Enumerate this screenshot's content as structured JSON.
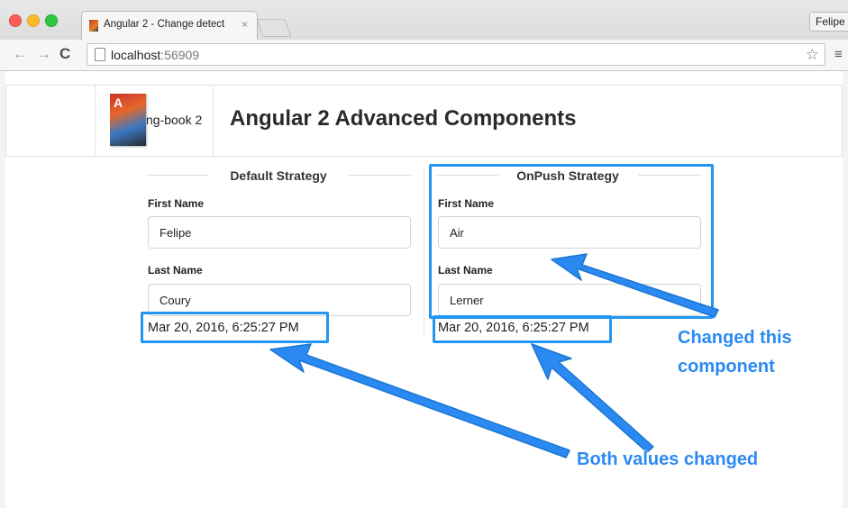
{
  "browser": {
    "tab_title": "Angular 2 - Change detect",
    "tab_close": "×",
    "user_button": "Felipe",
    "url_host": "localhost",
    "url_port": ":56909"
  },
  "header": {
    "brand_letter": "A",
    "brand_text": "ng-book 2",
    "title": "Angular 2 Advanced Components"
  },
  "default_strategy": {
    "legend": "Default Strategy",
    "first_name_label": "First Name",
    "first_name_value": "Felipe",
    "last_name_label": "Last Name",
    "last_name_value": "Coury",
    "timestamp": "Mar 20, 2016, 6:25:27 PM"
  },
  "onpush_strategy": {
    "legend": "OnPush Strategy",
    "first_name_label": "First Name",
    "first_name_value": "Air",
    "last_name_label": "Last Name",
    "last_name_value": "Lerner",
    "timestamp": "Mar 20, 2016, 6:25:27 PM"
  },
  "annotations": {
    "changed_component_line1": "Changed this",
    "changed_component_line2": "component",
    "both_values": "Both values changed"
  },
  "colors": {
    "annotation": "#2b8af2",
    "highlight": "#2196f3"
  }
}
